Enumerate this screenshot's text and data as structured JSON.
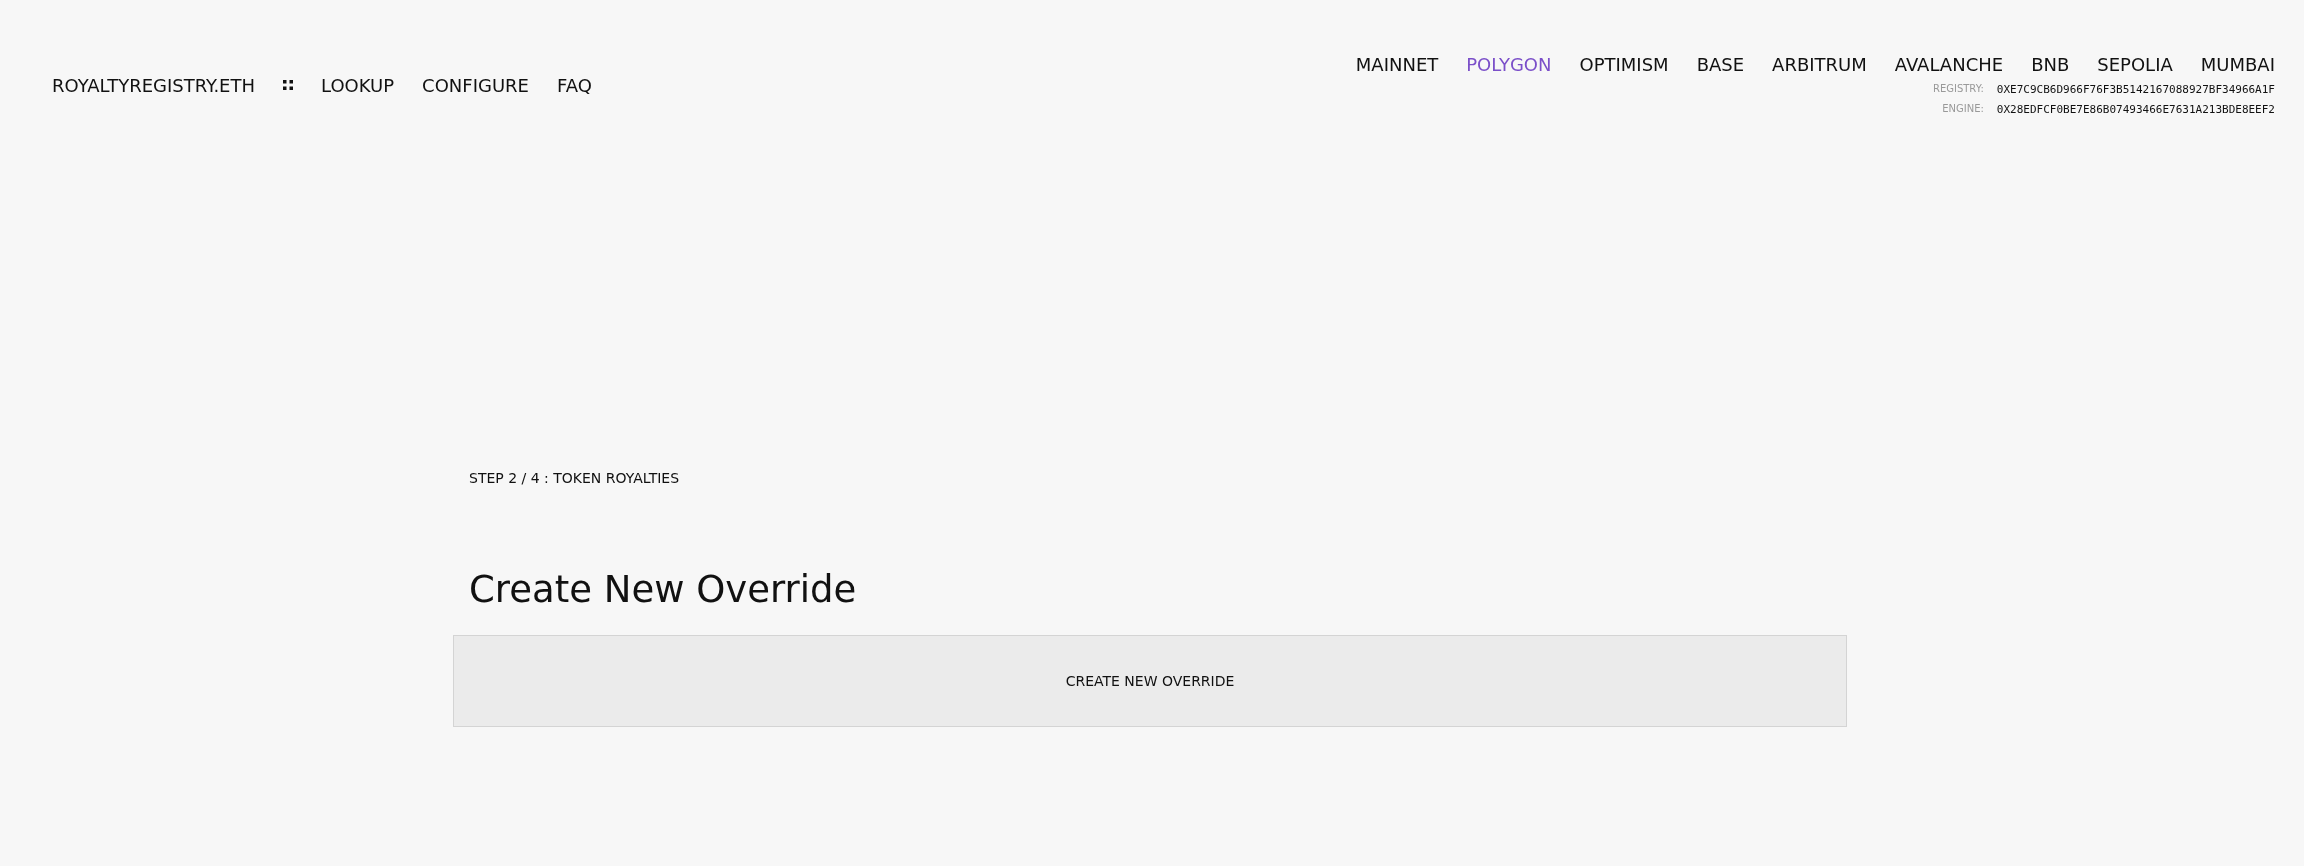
{
  "nav": {
    "brand": "ROYALTYREGISTRY.ETH",
    "links": [
      {
        "label": "LOOKUP"
      },
      {
        "label": "CONFIGURE"
      },
      {
        "label": "FAQ"
      }
    ]
  },
  "networks": [
    {
      "label": "MAINNET",
      "selected": false
    },
    {
      "label": "POLYGON",
      "selected": true
    },
    {
      "label": "OPTIMISM",
      "selected": false
    },
    {
      "label": "BASE",
      "selected": false
    },
    {
      "label": "ARBITRUM",
      "selected": false
    },
    {
      "label": "AVALANCHE",
      "selected": false
    },
    {
      "label": "BNB",
      "selected": false
    },
    {
      "label": "SEPOLIA",
      "selected": false
    },
    {
      "label": "MUMBAI",
      "selected": false
    }
  ],
  "addresses": [
    {
      "label": "REGISTRY:",
      "value": "0XE7C9CB6D966F76F3B5142167088927BF34966A1F"
    },
    {
      "label": "ENGINE:",
      "value": "0X28EDFCF0BE7E86B07493466E7631A213BDE8EEF2"
    }
  ],
  "step": "STEP 2 / 4 : TOKEN ROYALTIES",
  "heading": "Create New Override",
  "button": "CREATE NEW OVERRIDE"
}
